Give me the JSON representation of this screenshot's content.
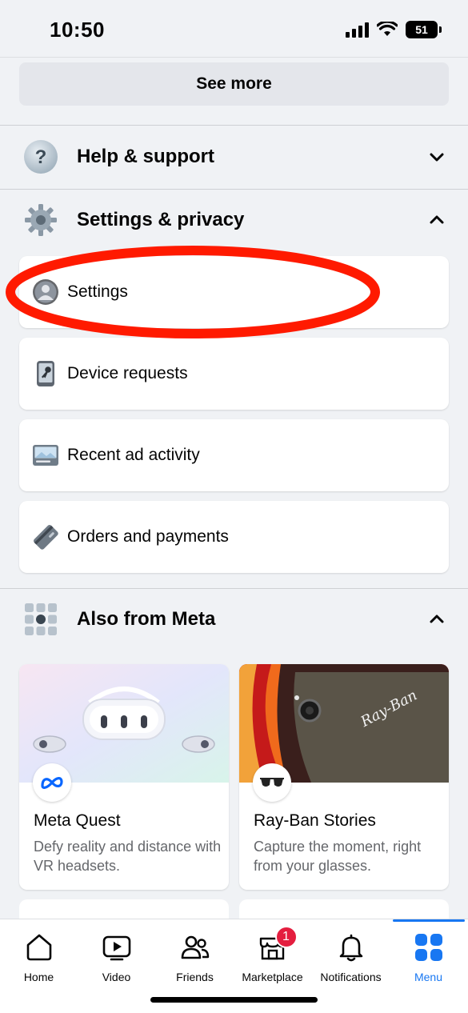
{
  "status_bar": {
    "time": "10:50",
    "battery": "51"
  },
  "see_more_label": "See more",
  "sections": {
    "help": {
      "label": "Help & support",
      "icon": "question-icon"
    },
    "settings_privacy": {
      "label": "Settings & privacy",
      "icon": "gear-icon",
      "items": [
        {
          "label": "Settings",
          "icon": "profile-icon"
        },
        {
          "label": "Device requests",
          "icon": "phone-key-icon"
        },
        {
          "label": "Recent ad activity",
          "icon": "ad-activity-icon"
        },
        {
          "label": "Orders and payments",
          "icon": "card-icon"
        }
      ]
    },
    "also_from_meta": {
      "label": "Also from Meta",
      "icon": "apps-grid-icon",
      "cards": [
        {
          "title": "Meta Quest",
          "description": "Defy reality and distance with VR headsets.",
          "icon": "meta-logo-icon"
        },
        {
          "title": "Ray-Ban Stories",
          "description": "Capture the moment, right from your glasses.",
          "icon": "sunglasses-icon",
          "hero_text": "Ray-Ban"
        }
      ]
    }
  },
  "tab_bar": {
    "tabs": [
      {
        "label": "Home",
        "icon": "home-icon"
      },
      {
        "label": "Video",
        "icon": "video-icon"
      },
      {
        "label": "Friends",
        "icon": "friends-icon"
      },
      {
        "label": "Marketplace",
        "icon": "marketplace-icon",
        "badge": "1"
      },
      {
        "label": "Notifications",
        "icon": "bell-icon"
      },
      {
        "label": "Menu",
        "icon": "menu-grid-icon",
        "active": true
      }
    ]
  },
  "colors": {
    "accent": "#1877f2",
    "highlight_ellipse": "#ff1a00",
    "badge": "#e41e3f"
  }
}
